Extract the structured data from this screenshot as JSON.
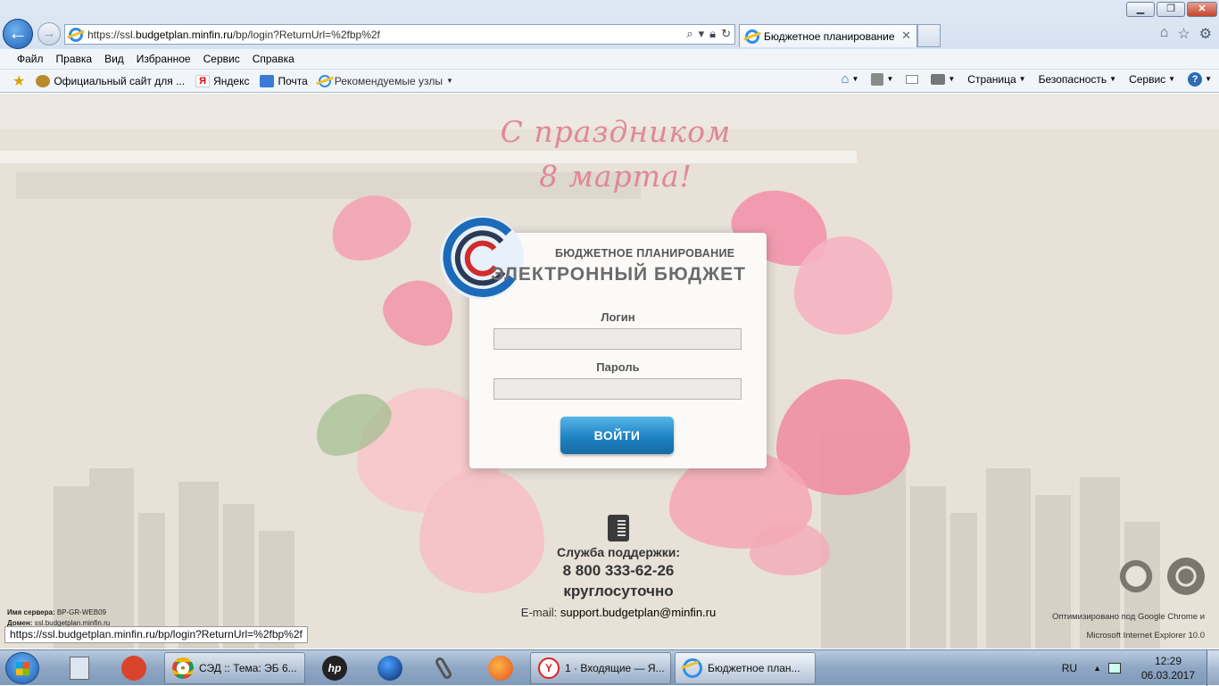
{
  "window": {
    "minimize": "▁",
    "restore": "❐",
    "close": "✕"
  },
  "address": {
    "prefix": "https://ssl.",
    "host": "budgetplan.minfin.ru",
    "path": "/bp/login?ReturnUrl=%2fbp%2f"
  },
  "tab": {
    "title": "Бюджетное планирование",
    "close": "✕"
  },
  "menu": [
    "Файл",
    "Правка",
    "Вид",
    "Избранное",
    "Сервис",
    "Справка"
  ],
  "favorites": [
    {
      "label": "Официальный сайт для ...",
      "icon": "coat-of-arms-icon"
    },
    {
      "label": "Яндекс",
      "icon": "yandex-icon"
    },
    {
      "label": "Почта",
      "icon": "mail-icon"
    },
    {
      "label": "Рекомендуемые узлы",
      "icon": "ie-icon"
    }
  ],
  "commands": {
    "page": "Страница",
    "security": "Безопасность",
    "service": "Сервис"
  },
  "page": {
    "greeting_line1": "С праздником",
    "greeting_line2": "8 марта!",
    "brand_sub": "БЮДЖЕТНОЕ ПЛАНИРОВАНИЕ",
    "brand_main": "ЭЛЕКТРОННЫЙ БЮДЖЕТ",
    "login_label": "Логин",
    "login_value": "",
    "password_label": "Пароль",
    "password_value": "",
    "login_button": "ВОЙТИ",
    "support_title": "Служба поддержки:",
    "support_phone": "8 800 333-62-26",
    "support_hours": "круглосуточно",
    "support_email_label": "E-mail:",
    "support_email": "support.budgetplan@minfin.ru",
    "server_label": "Имя сервера:",
    "server_value": "BP-GR-WEB09",
    "domain_label": "Домен:",
    "domain_value": "ssl.budgetplan.minfin.ru",
    "optimized_line1": "Оптимизировано под Google Chrome и",
    "optimized_line2": "Microsoft Internet Explorer 10.0",
    "status_url": "https://ssl.budgetplan.minfin.ru/bp/login?ReturnUrl=%2fbp%2f"
  },
  "taskbar": {
    "windows": [
      {
        "label": "СЭД :: Тема: ЭБ 6...",
        "icon": "chrome-icon"
      },
      {
        "label": "1 · Входящие — Я...",
        "icon": "yandex-browser-icon"
      },
      {
        "label": "Бюджетное план...",
        "icon": "ie-icon"
      }
    ],
    "lang": "RU",
    "time": "12:29",
    "date": "06.03.2017"
  },
  "colors": {
    "accent": "#1f83c4",
    "greeting": "#e08894",
    "page_bg": "#e7e1d7"
  }
}
